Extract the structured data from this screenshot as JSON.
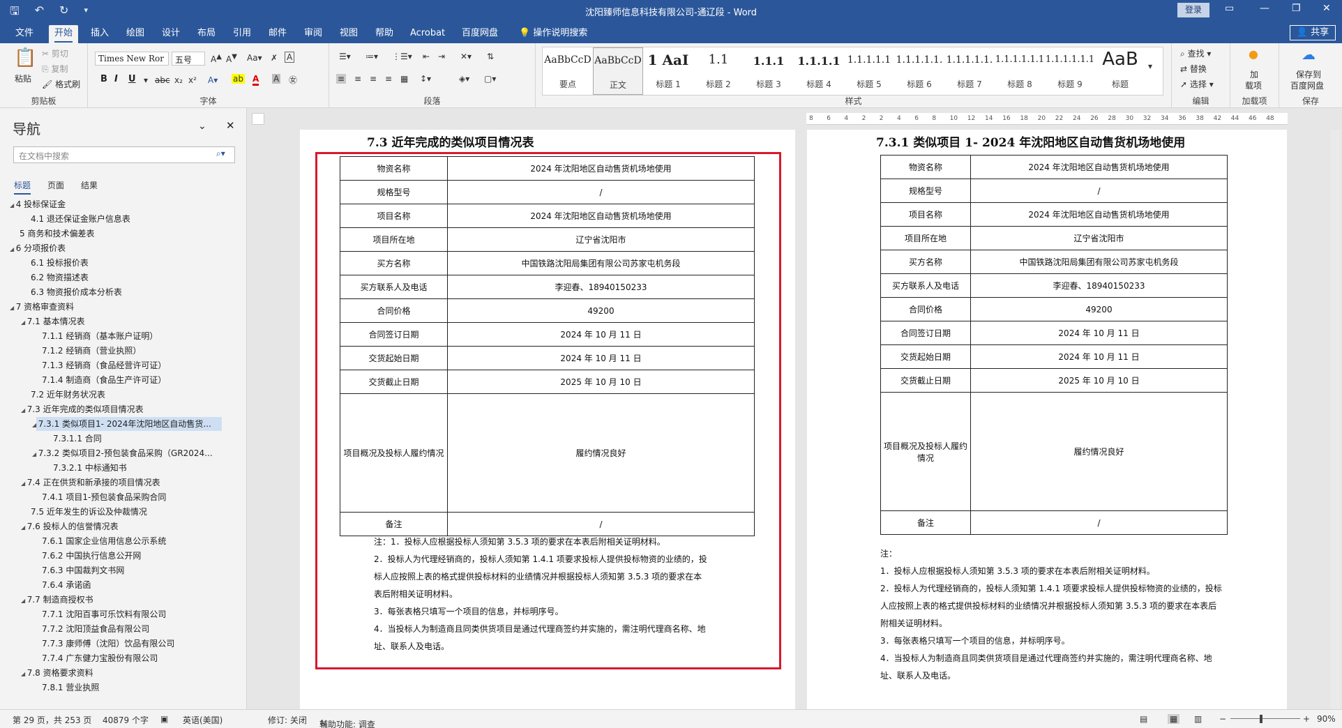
{
  "app": {
    "title": "沈阳臻师信息科技有限公司-通辽段  -  Word",
    "login": "登录",
    "share": "共享"
  },
  "tabs": [
    "文件",
    "开始",
    "插入",
    "绘图",
    "设计",
    "布局",
    "引用",
    "邮件",
    "审阅",
    "视图",
    "帮助",
    "Acrobat",
    "百度网盘"
  ],
  "tell_me": "操作说明搜索",
  "ribbon": {
    "clipboard": {
      "paste": "粘贴",
      "cut": "剪切",
      "copy": "复制",
      "painter": "格式刷",
      "label": "剪贴板"
    },
    "font": {
      "name": "Times New Ror",
      "size": "五号",
      "label": "字体"
    },
    "paragraph": {
      "label": "段落"
    },
    "styles": {
      "label": "样式",
      "items": [
        {
          "preview": "AaBbCcD",
          "name": "要点"
        },
        {
          "preview": "AaBbCcD",
          "name": "正文"
        },
        {
          "preview": "1 AaI",
          "name": "标题 1"
        },
        {
          "preview": "1.1",
          "name": "标题 2"
        },
        {
          "preview": "1.1.1",
          "name": "标题 3"
        },
        {
          "preview": "1.1.1.1",
          "name": "标题 4"
        },
        {
          "preview": "1.1.1.1.1",
          "name": "标题 5"
        },
        {
          "preview": "1.1.1.1.1.",
          "name": "标题 6"
        },
        {
          "preview": "1.1.1.1.1.",
          "name": "标题 7"
        },
        {
          "preview": "1.1.1.1.1.1",
          "name": "标题 8"
        },
        {
          "preview": "1.1.1.1.1.1",
          "name": "标题 9"
        },
        {
          "preview": "AaB",
          "name": "标题"
        }
      ]
    },
    "editing": {
      "find": "查找",
      "replace": "替换",
      "select": "选择",
      "label": "编辑"
    },
    "addins": {
      "label1": "加",
      "label2": "载项",
      "group": "加载项"
    },
    "baidu": {
      "label1": "保存到",
      "label2": "百度网盘",
      "group": "保存"
    }
  },
  "nav": {
    "title": "导航",
    "search_placeholder": "在文档中搜索",
    "tabs": [
      "标题",
      "页面",
      "结果"
    ],
    "items": [
      {
        "text": "4 投标保证金",
        "level": 1,
        "arrow": "▲"
      },
      {
        "text": "4.1 退还保证金账户信息表",
        "level": 2,
        "arrow": ""
      },
      {
        "text": "5 商务和技术偏差表",
        "level": 1,
        "arrow": ""
      },
      {
        "text": "6 分项报价表",
        "level": 1,
        "arrow": "▲"
      },
      {
        "text": "6.1 投标报价表",
        "level": 2,
        "arrow": ""
      },
      {
        "text": "6.2 物资描述表",
        "level": 2,
        "arrow": ""
      },
      {
        "text": "6.3 物资报价成本分析表",
        "level": 2,
        "arrow": ""
      },
      {
        "text": "7 资格审查资料",
        "level": 1,
        "arrow": "▲"
      },
      {
        "text": "7.1 基本情况表",
        "level": 2,
        "arrow": "▲"
      },
      {
        "text": "7.1.1 经销商（基本账户证明）",
        "level": 3,
        "arrow": ""
      },
      {
        "text": "7.1.2 经销商（营业执照）",
        "level": 3,
        "arrow": ""
      },
      {
        "text": "7.1.3 经销商（食品经营许可证）",
        "level": 3,
        "arrow": ""
      },
      {
        "text": "7.1.4 制造商（食品生产许可证）",
        "level": 3,
        "arrow": ""
      },
      {
        "text": "7.2 近年财务状况表",
        "level": 2,
        "arrow": ""
      },
      {
        "text": "7.3 近年完成的类似项目情况表",
        "level": 2,
        "arrow": "▲"
      },
      {
        "text": "7.3.1 类似项目1- 2024年沈阳地区自动售货...",
        "level": 3,
        "arrow": "▲",
        "selected": true
      },
      {
        "text": "7.3.1.1 合同",
        "level": 4,
        "arrow": ""
      },
      {
        "text": "7.3.2 类似项目2-预包装食品采购（GR2024...",
        "level": 3,
        "arrow": "▲"
      },
      {
        "text": "7.3.2.1 中标通知书",
        "level": 4,
        "arrow": ""
      },
      {
        "text": "7.4 正在供货和新承接的项目情况表",
        "level": 2,
        "arrow": "▲"
      },
      {
        "text": "7.4.1 项目1-预包装食品采购合同",
        "level": 3,
        "arrow": ""
      },
      {
        "text": "7.5 近年发生的诉讼及仲裁情况",
        "level": 2,
        "arrow": ""
      },
      {
        "text": "7.6 投标人的信誉情况表",
        "level": 2,
        "arrow": "▲"
      },
      {
        "text": "7.6.1 国家企业信用信息公示系统",
        "level": 3,
        "arrow": ""
      },
      {
        "text": "7.6.2 中国执行信息公开网",
        "level": 3,
        "arrow": ""
      },
      {
        "text": "7.6.3 中国裁判文书网",
        "level": 3,
        "arrow": ""
      },
      {
        "text": "7.6.4 承诺函",
        "level": 3,
        "arrow": ""
      },
      {
        "text": "7.7 制造商授权书",
        "level": 2,
        "arrow": "▲"
      },
      {
        "text": "7.7.1 沈阳百事可乐饮料有限公司",
        "level": 3,
        "arrow": ""
      },
      {
        "text": "7.7.2 沈阳顶益食品有限公司",
        "level": 3,
        "arrow": ""
      },
      {
        "text": "7.7.3 康师傅（沈阳）饮品有限公司",
        "level": 3,
        "arrow": ""
      },
      {
        "text": "7.7.4 广东健力宝股份有限公司",
        "level": 3,
        "arrow": ""
      },
      {
        "text": "7.8 资格要求资料",
        "level": 2,
        "arrow": "▲"
      },
      {
        "text": "7.8.1 营业执照",
        "level": 3,
        "arrow": ""
      }
    ]
  },
  "ruler_ticks": [
    "8",
    "6",
    "4",
    "2",
    "2",
    "4",
    "6",
    "8",
    "10",
    "12",
    "14",
    "16",
    "18",
    "20",
    "22",
    "24",
    "26",
    "28",
    "30",
    "32",
    "34",
    "36",
    "38",
    "42",
    "44",
    "46",
    "48"
  ],
  "left_page": {
    "heading": "7.3    近年完成的类似项目情况表",
    "rows": [
      {
        "label": "物资名称",
        "value": "2024 年沈阳地区自动售货机场地使用"
      },
      {
        "label": "规格型号",
        "value": "/"
      },
      {
        "label": "项目名称",
        "value": "2024 年沈阳地区自动售货机场地使用"
      },
      {
        "label": "项目所在地",
        "value": "辽宁省沈阳市"
      },
      {
        "label": "买方名称",
        "value": "中国铁路沈阳局集团有限公司苏家屯机务段"
      },
      {
        "label": "买方联系人及电话",
        "value": "李迎春、18940150233"
      },
      {
        "label": "合同价格",
        "value": "49200"
      },
      {
        "label": "合同签订日期",
        "value": "2024 年 10 月 11 日"
      },
      {
        "label": "交货起始日期",
        "value": "2024 年 10 月 11 日"
      },
      {
        "label": "交货截止日期",
        "value": "2025 年 10 月 10 日"
      },
      {
        "label": "项目概况及投标人履约情况",
        "value": "履约情况良好"
      },
      {
        "label": "备注",
        "value": "/"
      }
    ],
    "notes": [
      "注：1．投标人应根据投标人须知第 3.5.3 项的要求在本表后附相关证明材料。",
      "2．投标人为代理经销商的，投标人须知第 1.4.1 项要求投标人提供投标物资的业绩的，投",
      "标人应按照上表的格式提供投标材料的业绩情况并根据投标人须知第 3.5.3 项的要求在本",
      "表后附相关证明材料。",
      "3．每张表格只填写一个项目的信息，并标明序号。",
      "4．当投标人为制造商且同类供货项目是通过代理商签约并实施的，需注明代理商名称、地",
      "址、联系人及电话。"
    ]
  },
  "right_page": {
    "heading": "7.3.1  类似项目 1- 2024 年沈阳地区自动售货机场地使用",
    "rows": [
      {
        "label": "物资名称",
        "value": "2024 年沈阳地区自动售货机场地使用"
      },
      {
        "label": "规格型号",
        "value": "/"
      },
      {
        "label": "项目名称",
        "value": "2024 年沈阳地区自动售货机场地使用"
      },
      {
        "label": "项目所在地",
        "value": "辽宁省沈阳市"
      },
      {
        "label": "买方名称",
        "value": "中国铁路沈阳局集团有限公司苏家屯机务段"
      },
      {
        "label": "买方联系人及电话",
        "value": "李迎春、18940150233"
      },
      {
        "label": "合同价格",
        "value": "49200"
      },
      {
        "label": "合同签订日期",
        "value": "2024 年 10 月 11 日"
      },
      {
        "label": "交货起始日期",
        "value": "2024 年 10 月 11 日"
      },
      {
        "label": "交货截止日期",
        "value": "2025 年 10 月 10 日"
      },
      {
        "label": "项目概况及投标人履约情况",
        "value": "履约情况良好"
      },
      {
        "label": "备注",
        "value": "/"
      }
    ],
    "notes": [
      "注：",
      "1．投标人应根据投标人须知第 3.5.3 项的要求在本表后附相关证明材料。",
      "2．投标人为代理经销商的，投标人须知第 1.4.1 项要求投标人提供投标物资的业绩的，投标",
      "人应按照上表的格式提供投标材料的业绩情况并根据投标人须知第 3.5.3 项的要求在本表后",
      "附相关证明材料。",
      "3．每张表格只填写一个项目的信息，并标明序号。",
      "4．当投标人为制造商且同类供货项目是通过代理商签约并实施的，需注明代理商名称、地",
      "址、联系人及电话。"
    ]
  },
  "status": {
    "page": "第 29 页，共 253 页",
    "words": "40879 个字",
    "lang": "英语(美国)",
    "track": "修订: 关闭",
    "access": "辅助功能: 调查",
    "zoom": "90%"
  },
  "colors": {
    "word_blue": "#2b579a",
    "highlight_red": "#d9182d",
    "nav_selected": "#cfdff3"
  }
}
